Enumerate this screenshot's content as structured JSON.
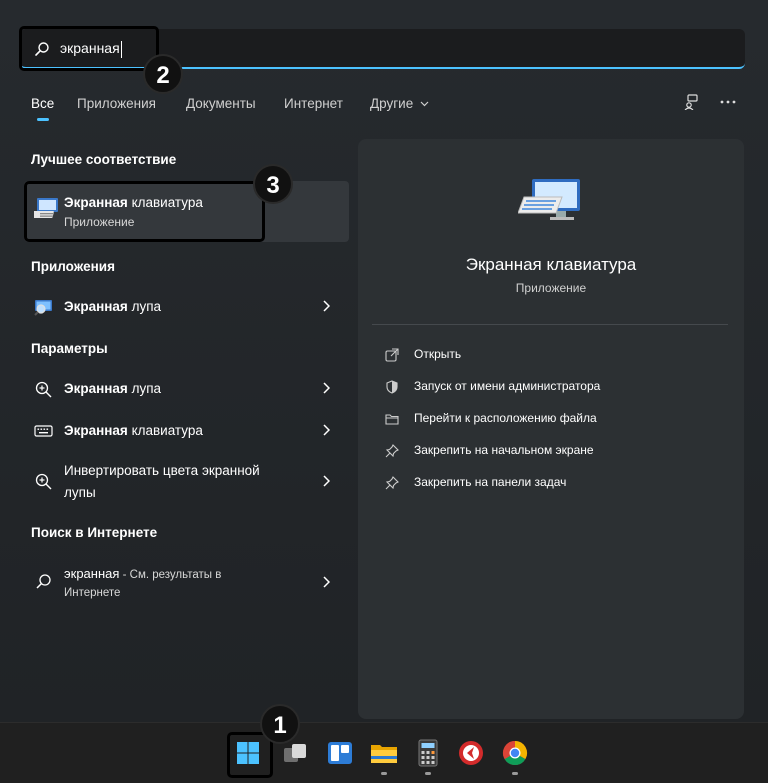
{
  "search": {
    "query": "экранная"
  },
  "tabs": [
    {
      "label": "Все"
    },
    {
      "label": "Приложения"
    },
    {
      "label": "Документы"
    },
    {
      "label": "Интернет"
    },
    {
      "label": "Другие"
    }
  ],
  "badges": {
    "one": "1",
    "two": "2",
    "three": "3"
  },
  "best_match": {
    "header": "Лучшее соответствие",
    "title_bold": "Экранная",
    "title_rest": " клавиатура",
    "subtitle": "Приложение"
  },
  "apps": {
    "header": "Приложения",
    "items": [
      {
        "bold": "Экранная",
        "rest": " лупа"
      }
    ]
  },
  "settings": {
    "header": "Параметры",
    "items": [
      {
        "bold": "Экранная",
        "rest": " лупа"
      },
      {
        "bold": "Экранная",
        "rest": " клавиатура"
      },
      {
        "line1": "Инвертировать цвета экранной",
        "line2": "лупы"
      }
    ]
  },
  "web": {
    "header": "Поиск в Интернете",
    "query": "экранная",
    "rest": " - См. результаты в",
    "line2": "Интернете"
  },
  "detail": {
    "title": "Экранная клавиатура",
    "subtitle": "Приложение",
    "actions": [
      {
        "label": "Открыть",
        "icon": "open-icon"
      },
      {
        "label": "Запуск от имени администратора",
        "icon": "shield-icon"
      },
      {
        "label": "Перейти к расположению файла",
        "icon": "folder-icon"
      },
      {
        "label": "Закрепить на начальном экране",
        "icon": "pin-icon"
      },
      {
        "label": "Закрепить на панели задач",
        "icon": "pin-icon"
      }
    ]
  },
  "taskbar": {
    "items": [
      "start-icon",
      "task-view-icon",
      "widgets-icon",
      "file-explorer-icon",
      "calculator-icon",
      "app-icon",
      "chrome-icon"
    ]
  },
  "colors": {
    "accent": "#4cc2ff",
    "panel": "#262a2e",
    "selected": "#34383c"
  }
}
